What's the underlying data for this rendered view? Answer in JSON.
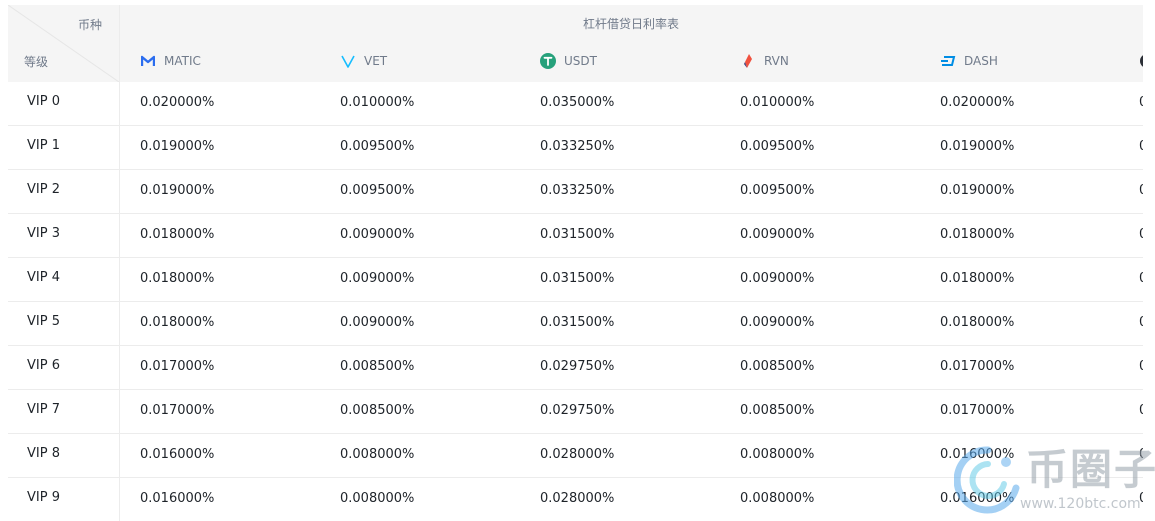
{
  "table": {
    "title": "杠杆借贷日利率表",
    "corner_currency": "币种",
    "corner_level": "等级",
    "coins": [
      {
        "symbol": "MATIC",
        "icon": "matic-icon",
        "color": "#2b6def"
      },
      {
        "symbol": "VET",
        "icon": "vet-icon",
        "color": "#15bdff"
      },
      {
        "symbol": "USDT",
        "icon": "usdt-icon",
        "color": "#26a17b"
      },
      {
        "symbol": "RVN",
        "icon": "rvn-icon",
        "color": "#f0513f"
      },
      {
        "symbol": "DASH",
        "icon": "dash-icon",
        "color": "#008de4"
      },
      {
        "symbol": "",
        "icon": "coin-icon",
        "color": "#2b2f36"
      }
    ],
    "rows": [
      {
        "level": "VIP 0",
        "rates": [
          "0.020000%",
          "0.010000%",
          "0.035000%",
          "0.010000%",
          "0.020000%",
          "0"
        ]
      },
      {
        "level": "VIP 1",
        "rates": [
          "0.019000%",
          "0.009500%",
          "0.033250%",
          "0.009500%",
          "0.019000%",
          "0"
        ]
      },
      {
        "level": "VIP 2",
        "rates": [
          "0.019000%",
          "0.009500%",
          "0.033250%",
          "0.009500%",
          "0.019000%",
          "0"
        ]
      },
      {
        "level": "VIP 3",
        "rates": [
          "0.018000%",
          "0.009000%",
          "0.031500%",
          "0.009000%",
          "0.018000%",
          "0"
        ]
      },
      {
        "level": "VIP 4",
        "rates": [
          "0.018000%",
          "0.009000%",
          "0.031500%",
          "0.009000%",
          "0.018000%",
          "0"
        ]
      },
      {
        "level": "VIP 5",
        "rates": [
          "0.018000%",
          "0.009000%",
          "0.031500%",
          "0.009000%",
          "0.018000%",
          "0"
        ]
      },
      {
        "level": "VIP 6",
        "rates": [
          "0.017000%",
          "0.008500%",
          "0.029750%",
          "0.008500%",
          "0.017000%",
          "0"
        ]
      },
      {
        "level": "VIP 7",
        "rates": [
          "0.017000%",
          "0.008500%",
          "0.029750%",
          "0.008500%",
          "0.017000%",
          "0"
        ]
      },
      {
        "level": "VIP 8",
        "rates": [
          "0.016000%",
          "0.008000%",
          "0.028000%",
          "0.008000%",
          "0.016000%",
          "0"
        ]
      },
      {
        "level": "VIP 9",
        "rates": [
          "0.016000%",
          "0.008000%",
          "0.028000%",
          "0.008000%",
          "0.016000%",
          "0"
        ]
      }
    ]
  },
  "watermark": {
    "title": "币圈子",
    "url": "www.120btc.com"
  }
}
